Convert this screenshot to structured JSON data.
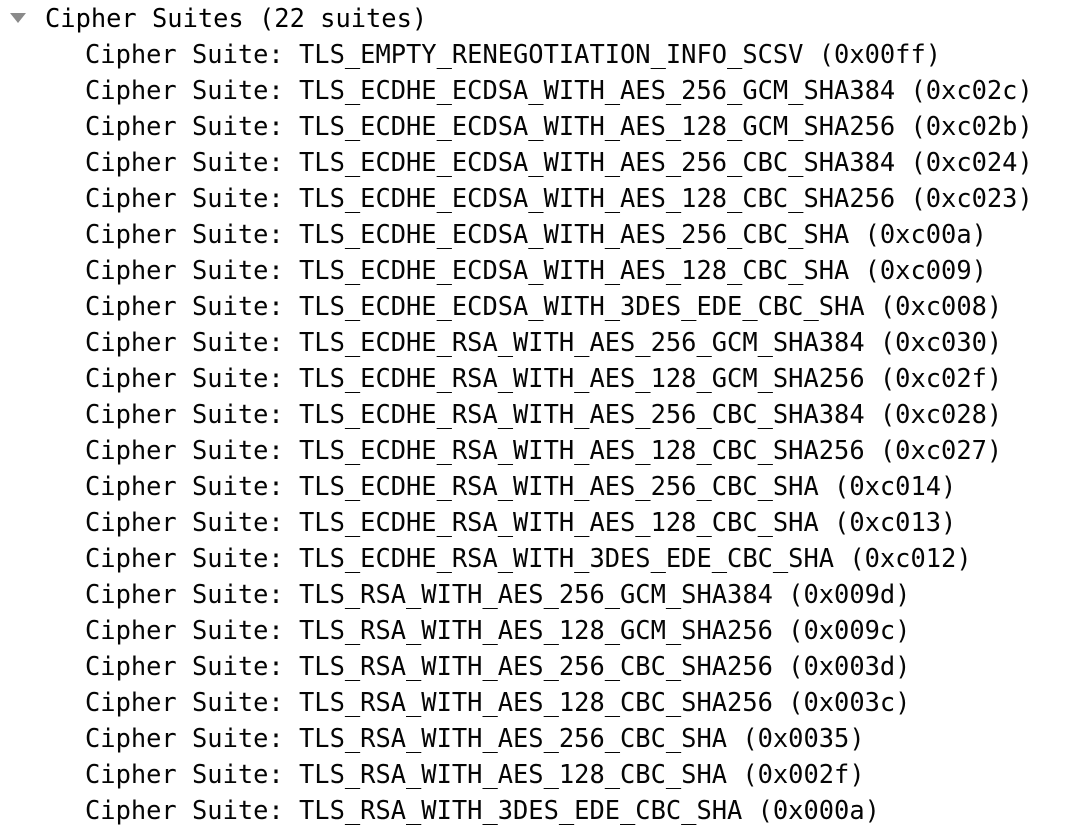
{
  "tree": {
    "expanded": true,
    "twisty_icon": "triangle-down-icon",
    "twisty_color": "#8a8a8a",
    "text_color": "#050505",
    "background_color": "#ffffff",
    "root": {
      "label": "Cipher Suites (22 suites)",
      "name": "Cipher Suites",
      "count_text": "(22 suites)",
      "count": 22
    },
    "field_label": "Cipher Suite: ",
    "suites": [
      {
        "line": "Cipher Suite: TLS_EMPTY_RENEGOTIATION_INFO_SCSV (0x00ff)",
        "name": "TLS_EMPTY_RENEGOTIATION_INFO_SCSV",
        "code": "0x00ff"
      },
      {
        "line": "Cipher Suite: TLS_ECDHE_ECDSA_WITH_AES_256_GCM_SHA384 (0xc02c)",
        "name": "TLS_ECDHE_ECDSA_WITH_AES_256_GCM_SHA384",
        "code": "0xc02c"
      },
      {
        "line": "Cipher Suite: TLS_ECDHE_ECDSA_WITH_AES_128_GCM_SHA256 (0xc02b)",
        "name": "TLS_ECDHE_ECDSA_WITH_AES_128_GCM_SHA256",
        "code": "0xc02b"
      },
      {
        "line": "Cipher Suite: TLS_ECDHE_ECDSA_WITH_AES_256_CBC_SHA384 (0xc024)",
        "name": "TLS_ECDHE_ECDSA_WITH_AES_256_CBC_SHA384",
        "code": "0xc024"
      },
      {
        "line": "Cipher Suite: TLS_ECDHE_ECDSA_WITH_AES_128_CBC_SHA256 (0xc023)",
        "name": "TLS_ECDHE_ECDSA_WITH_AES_128_CBC_SHA256",
        "code": "0xc023"
      },
      {
        "line": "Cipher Suite: TLS_ECDHE_ECDSA_WITH_AES_256_CBC_SHA (0xc00a)",
        "name": "TLS_ECDHE_ECDSA_WITH_AES_256_CBC_SHA",
        "code": "0xc00a"
      },
      {
        "line": "Cipher Suite: TLS_ECDHE_ECDSA_WITH_AES_128_CBC_SHA (0xc009)",
        "name": "TLS_ECDHE_ECDSA_WITH_AES_128_CBC_SHA",
        "code": "0xc009"
      },
      {
        "line": "Cipher Suite: TLS_ECDHE_ECDSA_WITH_3DES_EDE_CBC_SHA (0xc008)",
        "name": "TLS_ECDHE_ECDSA_WITH_3DES_EDE_CBC_SHA",
        "code": "0xc008"
      },
      {
        "line": "Cipher Suite: TLS_ECDHE_RSA_WITH_AES_256_GCM_SHA384 (0xc030)",
        "name": "TLS_ECDHE_RSA_WITH_AES_256_GCM_SHA384",
        "code": "0xc030"
      },
      {
        "line": "Cipher Suite: TLS_ECDHE_RSA_WITH_AES_128_GCM_SHA256 (0xc02f)",
        "name": "TLS_ECDHE_RSA_WITH_AES_128_GCM_SHA256",
        "code": "0xc02f"
      },
      {
        "line": "Cipher Suite: TLS_ECDHE_RSA_WITH_AES_256_CBC_SHA384 (0xc028)",
        "name": "TLS_ECDHE_RSA_WITH_AES_256_CBC_SHA384",
        "code": "0xc028"
      },
      {
        "line": "Cipher Suite: TLS_ECDHE_RSA_WITH_AES_128_CBC_SHA256 (0xc027)",
        "name": "TLS_ECDHE_RSA_WITH_AES_128_CBC_SHA256",
        "code": "0xc027"
      },
      {
        "line": "Cipher Suite: TLS_ECDHE_RSA_WITH_AES_256_CBC_SHA (0xc014)",
        "name": "TLS_ECDHE_RSA_WITH_AES_256_CBC_SHA",
        "code": "0xc014"
      },
      {
        "line": "Cipher Suite: TLS_ECDHE_RSA_WITH_AES_128_CBC_SHA (0xc013)",
        "name": "TLS_ECDHE_RSA_WITH_AES_128_CBC_SHA",
        "code": "0xc013"
      },
      {
        "line": "Cipher Suite: TLS_ECDHE_RSA_WITH_3DES_EDE_CBC_SHA (0xc012)",
        "name": "TLS_ECDHE_RSA_WITH_3DES_EDE_CBC_SHA",
        "code": "0xc012"
      },
      {
        "line": "Cipher Suite: TLS_RSA_WITH_AES_256_GCM_SHA384 (0x009d)",
        "name": "TLS_RSA_WITH_AES_256_GCM_SHA384",
        "code": "0x009d"
      },
      {
        "line": "Cipher Suite: TLS_RSA_WITH_AES_128_GCM_SHA256 (0x009c)",
        "name": "TLS_RSA_WITH_AES_128_GCM_SHA256",
        "code": "0x009c"
      },
      {
        "line": "Cipher Suite: TLS_RSA_WITH_AES_256_CBC_SHA256 (0x003d)",
        "name": "TLS_RSA_WITH_AES_256_CBC_SHA256",
        "code": "0x003d"
      },
      {
        "line": "Cipher Suite: TLS_RSA_WITH_AES_128_CBC_SHA256 (0x003c)",
        "name": "TLS_RSA_WITH_AES_128_CBC_SHA256",
        "code": "0x003c"
      },
      {
        "line": "Cipher Suite: TLS_RSA_WITH_AES_256_CBC_SHA (0x0035)",
        "name": "TLS_RSA_WITH_AES_256_CBC_SHA",
        "code": "0x0035"
      },
      {
        "line": "Cipher Suite: TLS_RSA_WITH_AES_128_CBC_SHA (0x002f)",
        "name": "TLS_RSA_WITH_AES_128_CBC_SHA",
        "code": "0x002f"
      },
      {
        "line": "Cipher Suite: TLS_RSA_WITH_3DES_EDE_CBC_SHA (0x000a)",
        "name": "TLS_RSA_WITH_3DES_EDE_CBC_SHA",
        "code": "0x000a"
      }
    ]
  }
}
